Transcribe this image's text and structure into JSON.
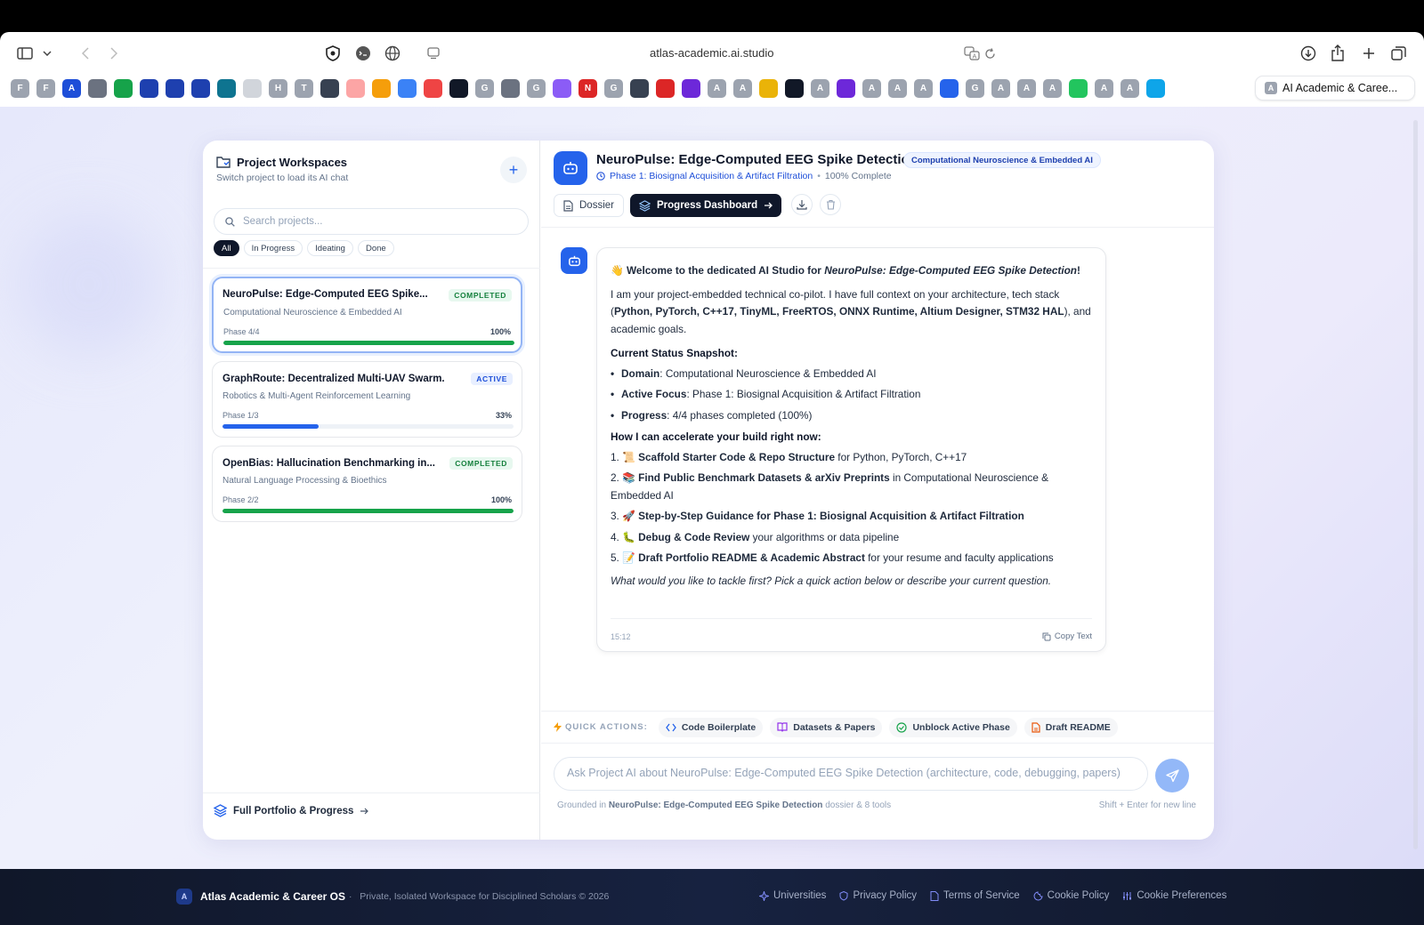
{
  "browser": {
    "url": "atlas-academic.ai.studio",
    "active_tab_label": "AI Academic & Caree...",
    "favorites": [
      {
        "letter": "F",
        "color": "#9ca3af"
      },
      {
        "letter": "F",
        "color": "#9ca3af"
      },
      {
        "letter": "A",
        "color": "#1d4ed8"
      },
      {
        "letter": "",
        "color": "#6b7280"
      },
      {
        "letter": "",
        "color": "#16a34a"
      },
      {
        "letter": "",
        "color": "#1e40af"
      },
      {
        "letter": "",
        "color": "#1e40af"
      },
      {
        "letter": "",
        "color": "#1e40af"
      },
      {
        "letter": "",
        "color": "#0e7490"
      },
      {
        "letter": "",
        "color": "#d1d5db"
      },
      {
        "letter": "H",
        "color": "#9ca3af"
      },
      {
        "letter": "T",
        "color": "#9ca3af"
      },
      {
        "letter": "",
        "color": "#374151"
      },
      {
        "letter": "",
        "color": "#fca5a5"
      },
      {
        "letter": "",
        "color": "#f59e0b"
      },
      {
        "letter": "",
        "color": "#3b82f6"
      },
      {
        "letter": "",
        "color": "#ef4444"
      },
      {
        "letter": "",
        "color": "#111827"
      },
      {
        "letter": "G",
        "color": "#9ca3af"
      },
      {
        "letter": "",
        "color": "#6b7280"
      },
      {
        "letter": "G",
        "color": "#9ca3af"
      },
      {
        "letter": "",
        "color": "#8b5cf6"
      },
      {
        "letter": "N",
        "color": "#dc2626"
      },
      {
        "letter": "G",
        "color": "#9ca3af"
      },
      {
        "letter": "",
        "color": "#374151"
      },
      {
        "letter": "",
        "color": "#dc2626"
      },
      {
        "letter": "",
        "color": "#6d28d9"
      },
      {
        "letter": "A",
        "color": "#9ca3af"
      },
      {
        "letter": "A",
        "color": "#9ca3af"
      },
      {
        "letter": "",
        "color": "#eab308"
      },
      {
        "letter": "",
        "color": "#111827"
      },
      {
        "letter": "A",
        "color": "#9ca3af"
      },
      {
        "letter": "",
        "color": "#6d28d9"
      },
      {
        "letter": "A",
        "color": "#9ca3af"
      },
      {
        "letter": "A",
        "color": "#9ca3af"
      },
      {
        "letter": "A",
        "color": "#9ca3af"
      },
      {
        "letter": "",
        "color": "#2563eb"
      },
      {
        "letter": "G",
        "color": "#9ca3af"
      },
      {
        "letter": "A",
        "color": "#9ca3af"
      },
      {
        "letter": "A",
        "color": "#9ca3af"
      },
      {
        "letter": "A",
        "color": "#9ca3af"
      },
      {
        "letter": "",
        "color": "#22c55e"
      },
      {
        "letter": "A",
        "color": "#9ca3af"
      },
      {
        "letter": "A",
        "color": "#9ca3af"
      },
      {
        "letter": "",
        "color": "#0ea5e9"
      }
    ]
  },
  "sidebar": {
    "title": "Project Workspaces",
    "subtitle": "Switch project to load its AI chat",
    "search_placeholder": "Search projects...",
    "filters": [
      "All",
      "In Progress",
      "Ideating",
      "Done"
    ],
    "projects": [
      {
        "name": "NeuroPulse: Edge-Computed EEG Spike...",
        "badge": "COMPLETED",
        "domain": "Computational Neuroscience & Embedded AI",
        "phase": "Phase 4/4",
        "percent": "100%",
        "progress": 1.0,
        "color": "#16a34a"
      },
      {
        "name": "GraphRoute: Decentralized Multi-UAV Swarm...",
        "badge": "ACTIVE",
        "domain": "Robotics & Multi-Agent Reinforcement Learning",
        "phase": "Phase 1/3",
        "percent": "33%",
        "progress": 0.33,
        "color": "#2563eb"
      },
      {
        "name": "OpenBias: Hallucination Benchmarking in...",
        "badge": "COMPLETED",
        "domain": "Natural Language Processing & Bioethics",
        "phase": "Phase 2/2",
        "percent": "100%",
        "progress": 1.0,
        "color": "#16a34a"
      }
    ],
    "footer_link": "Full Portfolio & Progress"
  },
  "main": {
    "title": "NeuroPulse: Edge-Computed EEG Spike Detection",
    "domain_badge": "Computational Neuroscience & Embedded AI",
    "phase": "Phase 1: Biosignal Acquisition & Artifact Filtration",
    "complete": "100% Complete",
    "dossier_label": "Dossier",
    "dashboard_label": "Progress Dashboard",
    "message": {
      "wave": "👋",
      "welcome_prefix": "Welcome to the dedicated AI Studio for ",
      "welcome_project": "NeuroPulse: Edge-Computed EEG Spike Detection",
      "welcome_suffix": "!",
      "intro_prefix": "I am your project-embedded technical co-pilot. I have full context on your architecture, tech stack (",
      "intro_stack": "Python, PyTorch, C++17, TinyML, FreeRTOS, ONNX Runtime, Altium Designer, STM32 HAL",
      "intro_suffix": "), and academic goals.",
      "status_heading": "Current Status Snapshot:",
      "status": [
        {
          "key": "Domain",
          "value": ": Computational Neuroscience & Embedded AI"
        },
        {
          "key": "Active Focus",
          "value": ": Phase 1: Biosignal Acquisition & Artifact Filtration"
        },
        {
          "key": "Progress",
          "value": ": 4/4 phases completed (100%)"
        }
      ],
      "help_heading": "How I can accelerate your build right now:",
      "help": [
        {
          "num": "1.",
          "emoji": "📜",
          "bold": "Scaffold Starter Code & Repo Structure",
          "rest": " for Python, PyTorch, C++17"
        },
        {
          "num": "2.",
          "emoji": "📚",
          "bold": "Find Public Benchmark Datasets & arXiv Preprints",
          "rest": " in Computational Neuroscience & Embedded AI"
        },
        {
          "num": "3.",
          "emoji": "🚀",
          "bold": "Step-by-Step Guidance for Phase 1: Biosignal Acquisition & Artifact Filtration",
          "rest": ""
        },
        {
          "num": "4.",
          "emoji": "🐛",
          "bold": "Debug & Code Review",
          "rest": " your algorithms or data pipeline"
        },
        {
          "num": "5.",
          "emoji": "📝",
          "bold": "Draft Portfolio README & Academic Abstract",
          "rest": " for your resume and faculty applications"
        }
      ],
      "closing": "What would you like to tackle first? Pick a quick action below or describe your current question.",
      "time": "15:12",
      "copy_label": "Copy Text"
    },
    "quick_actions_label": "QUICK ACTIONS:",
    "quick_actions": [
      "Code Boilerplate",
      "Datasets & Papers",
      "Unblock Active Phase",
      "Draft README"
    ],
    "input_placeholder": "Ask Project AI about NeuroPulse: Edge-Computed EEG Spike Detection (architecture, code, debugging, papers)",
    "grounded_prefix": "Grounded in ",
    "grounded_project": "NeuroPulse: Edge-Computed EEG Spike Detection",
    "grounded_suffix": " dossier & 8 tools",
    "shift_hint": "Shift + Enter for new line"
  },
  "footer": {
    "logo_letter": "A",
    "brand": "Atlas Academic & Career OS",
    "tagline": "Private, Isolated Workspace for Disciplined Scholars © 2026",
    "links": [
      "Universities",
      "Privacy Policy",
      "Terms of Service",
      "Cookie Policy",
      "Cookie Preferences"
    ]
  }
}
